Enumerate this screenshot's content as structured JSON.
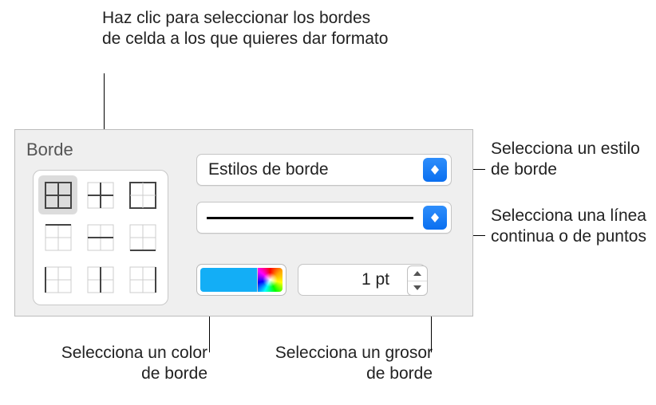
{
  "callouts": {
    "top": "Haz clic para seleccionar los bordes de celda a los que quieres dar formato",
    "style": "Selecciona un estilo de borde",
    "line": "Selecciona una línea continua o de puntos",
    "color": "Selecciona un color de borde",
    "thickness": "Selecciona un grosor de borde"
  },
  "panel": {
    "title": "Borde",
    "popup_style": "Estilos de borde",
    "thickness_value": "1 pt",
    "swatch_color": "#13aef6"
  }
}
